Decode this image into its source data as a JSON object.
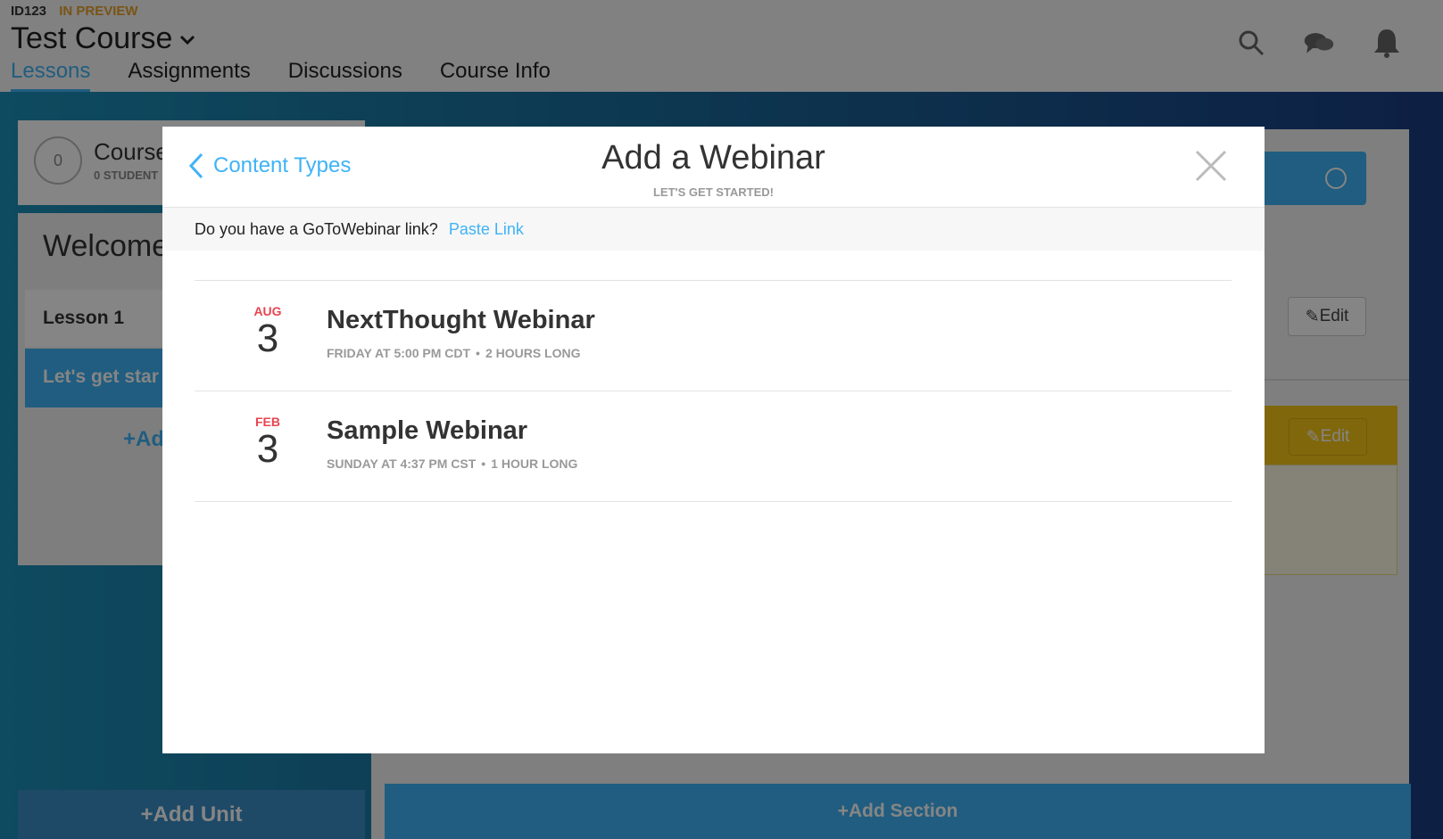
{
  "header": {
    "course_id": "ID123",
    "status": "IN PREVIEW",
    "course_title": "Test Course",
    "tabs": [
      {
        "label": "Lessons",
        "active": true
      },
      {
        "label": "Assignments",
        "active": false
      },
      {
        "label": "Discussions",
        "active": false
      },
      {
        "label": "Course Info",
        "active": false
      }
    ],
    "icons": [
      "search-icon",
      "chat-icon",
      "bell-icon"
    ]
  },
  "background": {
    "course_card": {
      "count": "0",
      "name": "Course",
      "students": "0 STUDENT"
    },
    "outline": {
      "title": "Welcome!",
      "lesson": "Lesson 1",
      "selected_item": "Let's get star",
      "add_lesson": "+Ad"
    },
    "add_unit": "+Add Unit",
    "edit_label": "Edit",
    "add_section": "+Add Section"
  },
  "modal": {
    "back_label": "Content Types",
    "title": "Add a Webinar",
    "subtitle": "LET'S GET STARTED!",
    "paste_question": "Do you have a GoToWebinar link?",
    "paste_link": "Paste Link",
    "webinars": [
      {
        "month": "AUG",
        "day": "3",
        "name": "NextThought Webinar",
        "when": "FRIDAY AT 5:00 PM CDT",
        "duration": "2 HOURS LONG"
      },
      {
        "month": "FEB",
        "day": "3",
        "name": "Sample Webinar",
        "when": "SUNDAY AT 4:37 PM CST",
        "duration": "1 HOUR LONG"
      }
    ]
  },
  "colors": {
    "accent": "#3fb3f6",
    "month": "#e8444f",
    "preview": "#e8a22a"
  }
}
